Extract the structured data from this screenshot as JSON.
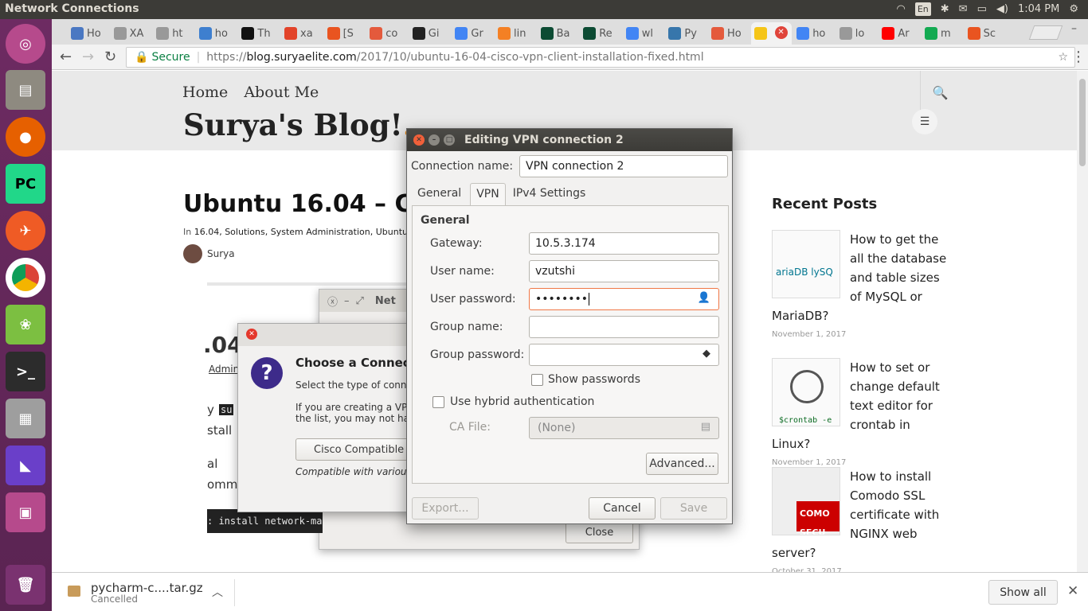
{
  "topbar": {
    "title": "Network Connections",
    "lang": "En",
    "time": "1:04 PM"
  },
  "launcher": {
    "items": [
      "ubuntu-dash",
      "files",
      "firefox",
      "pycharm",
      "postman",
      "chrome",
      "robomongo",
      "terminal",
      "calculator",
      "visual-studio",
      "network"
    ],
    "trash": "trash"
  },
  "browser": {
    "tabs": [
      {
        "label": "Ho",
        "color": "#4a78c2"
      },
      {
        "label": "XA",
        "color": "#999999"
      },
      {
        "label": "ht",
        "color": "#999999"
      },
      {
        "label": "ho",
        "color": "#3e7fcf"
      },
      {
        "label": "Th",
        "color": "#111111"
      },
      {
        "label": "xa",
        "color": "#e24329"
      },
      {
        "label": "[S",
        "color": "#e95420"
      },
      {
        "label": "co",
        "color": "#e45a3c"
      },
      {
        "label": "Gi",
        "color": "#222222"
      },
      {
        "label": "Gr",
        "color": "#4285f4"
      },
      {
        "label": "lin",
        "color": "#f48024"
      },
      {
        "label": "Ba",
        "color": "#0c4b33"
      },
      {
        "label": "Re",
        "color": "#0c4b33"
      },
      {
        "label": "wl",
        "color": "#4285f4"
      },
      {
        "label": "Py",
        "color": "#3776ab"
      },
      {
        "label": "Ho",
        "color": "#e45a3c"
      },
      {
        "label": "",
        "color": "#f5c518"
      },
      {
        "label": "ho",
        "color": "#4285f4"
      },
      {
        "label": "lo",
        "color": "#999999"
      },
      {
        "label": "Ar",
        "color": "#ff0000"
      },
      {
        "label": "m",
        "color": "#13aa52"
      },
      {
        "label": "Sc",
        "color": "#e95420"
      }
    ],
    "secure_label": "Secure",
    "url_scheme": "https://",
    "url_host": "blog.suryaelite.com",
    "url_path": "/2017/10/ubuntu-16-04-cisco-vpn-client-installation-fixed.html"
  },
  "page": {
    "nav": [
      "Home",
      "About Me"
    ],
    "blog_title": "Surya's Blog!",
    "blog_dot": ".",
    "post_title": "Ubuntu 16.04 – Cis",
    "meta_prefix": "In ",
    "meta_cats": "16.04, Solutions, System Administration, Ubuntu",
    "author": "Surya",
    "recent_posts_title": "Recent Posts",
    "recent_posts": [
      {
        "title": "How to get the all the database and table sizes of MySQL or MariaDB?",
        "date": "November 1, 2017",
        "thumb": "ariaDB lySQ"
      },
      {
        "title": "How to set or change default text editor for crontab in Linux?",
        "date": "November 1, 2017",
        "thumb": "$crontab -e"
      },
      {
        "title": "How to install Comodo SSL certificate with NGINX web server?",
        "date": "October 31, 2017",
        "thumb": "COMO SECU"
      }
    ],
    "partial_04": ".04",
    "partial_admin": "Admini",
    "partial_y": "y",
    "partial_su": "su",
    "partial_stall": "stall",
    "partial_al": "al",
    "partial_omma": "omma",
    "terminal_text": ": install network-ma"
  },
  "network_dialog": {
    "title": "Net",
    "close_label": "Close"
  },
  "choose_dialog": {
    "heading": "Choose a Connecti",
    "subtext": "Select the type of conne",
    "para1": "If you are creating a VPN",
    "para2": "the list, you may not hav",
    "combo_value": "Cisco Compatible V",
    "description": "Compatible with various"
  },
  "vpn_dialog": {
    "title": "Editing VPN connection 2",
    "connection_name_label": "Connection name:",
    "connection_name": "VPN connection 2",
    "tabs": [
      "General",
      "VPN",
      "IPv4 Settings"
    ],
    "section": "General",
    "gateway_label": "Gateway:",
    "gateway": "10.5.3.174",
    "username_label": "User name:",
    "username": "vzutshi",
    "password_label": "User password:",
    "password": "••••••••",
    "group_name_label": "Group name:",
    "group_name": "",
    "group_password_label": "Group password:",
    "group_password": "",
    "show_passwords": "Show passwords",
    "hybrid_auth": "Use hybrid authentication",
    "ca_file_label": "CA File:",
    "ca_file": "(None)",
    "advanced": "Advanced...",
    "export": "Export...",
    "cancel": "Cancel",
    "save": "Save"
  },
  "downloads": {
    "file": "pycharm-c....tar.gz",
    "status": "Cancelled",
    "show_all": "Show all"
  }
}
